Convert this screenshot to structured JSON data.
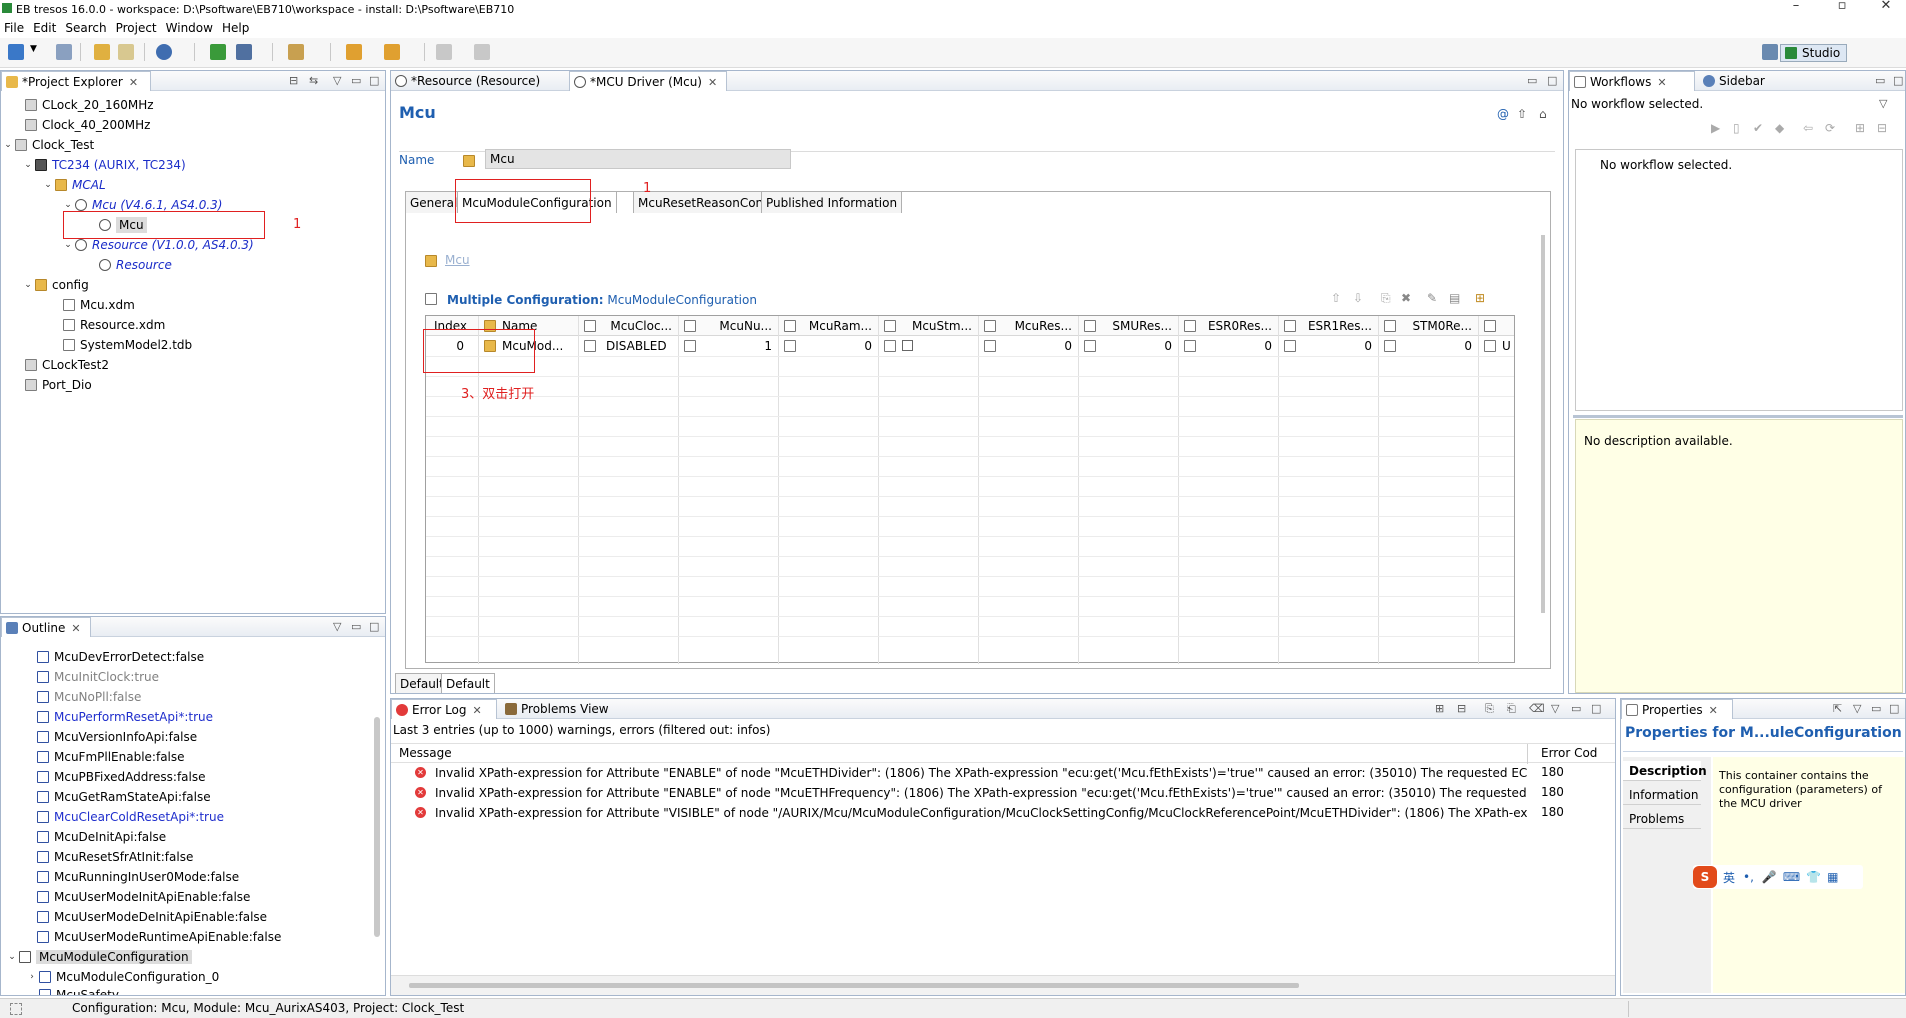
{
  "window": {
    "title": "EB tresos 16.0.0 - workspace: D:\\Psoftware\\EB710\\workspace - install: D:\\Psoftware\\EB710",
    "minimize": "–",
    "maximize": "▫",
    "close": "✕"
  },
  "menu": [
    "File",
    "Edit",
    "Search",
    "Project",
    "Window",
    "Help"
  ],
  "toolbar": {
    "studio_label": "Studio"
  },
  "project_explorer": {
    "tab": "*Project Explorer",
    "items": [
      {
        "label": "CLock_20_160MHz"
      },
      {
        "label": "Clock_40_200MHz"
      },
      {
        "label": "Clock_Test"
      },
      {
        "label": "TC234 (AURIX, TC234)"
      },
      {
        "label": "MCAL"
      },
      {
        "label": "Mcu (V4.6.1, AS4.0.3)"
      },
      {
        "label": "Mcu"
      },
      {
        "label": "Resource (V1.0.0, AS4.0.3)"
      },
      {
        "label": "Resource"
      },
      {
        "label": "config"
      },
      {
        "label": "Mcu.xdm"
      },
      {
        "label": "Resource.xdm"
      },
      {
        "label": "SystemModel2.tdb"
      },
      {
        "label": "CLockTest2"
      },
      {
        "label": "Port_Dio"
      }
    ],
    "annotation": "1"
  },
  "outline": {
    "tab": "Outline",
    "items": [
      "McuDevErrorDetect:false",
      "McuInitClock:true",
      "McuNoPll:false",
      "McuPerformResetApi*:true",
      "McuVersionInfoApi:false",
      "McuFmPllEnable:false",
      "McuPBFixedAddress:false",
      "McuGetRamStateApi:false",
      "McuClearColdResetApi*:true",
      "McuDeInitApi:false",
      "McuResetSfrAtInit:false",
      "McuRunningInUser0Mode:false",
      "McuUserModeInitApiEnable:false",
      "McuUserModeDeInitApiEnable:false",
      "McuUserModeRuntimeApiEnable:false",
      "McuModuleConfiguration",
      "McuModuleConfiguration_0",
      "McuSafety"
    ]
  },
  "editor": {
    "tabs": [
      "*Resource (Resource)",
      "*MCU Driver (Mcu)"
    ],
    "title": "Mcu",
    "name_label": "Name",
    "name_value": "Mcu",
    "subtabs": [
      "General",
      "McuModuleConfiguration",
      "McuResetReasonConf",
      "Published Information"
    ],
    "annotation1": "1",
    "breadcrumb": "Mcu",
    "multi_config_label": "Multiple Configuration:",
    "multi_config_value": "McuModuleConfiguration",
    "columns": [
      "Index",
      "Name",
      "McuCloc...",
      "McuNu...",
      "McuRam...",
      "McuStm...",
      "McuRes...",
      "SMURes...",
      "ESR0Res...",
      "ESR1Res...",
      "STM0Re...",
      ""
    ],
    "row": [
      "0",
      "McuMod...",
      "DISABLED",
      "1",
      "0",
      "",
      "0",
      "0",
      "0",
      "0",
      "0",
      "U"
    ],
    "annotation3": "3、双击打开",
    "bottom_tabs": [
      "Default",
      "Default"
    ]
  },
  "workflows": {
    "tabs": [
      "Workflows",
      "Sidebar"
    ],
    "status": "No workflow selected.",
    "inner_status": "No workflow selected.",
    "description": "No description available."
  },
  "error_log": {
    "tabs": [
      "Error Log",
      "Problems View"
    ],
    "summary": "Last 3 entries (up to 1000) warnings, errors (filtered out: infos)",
    "col_message": "Message",
    "col_error_code": "Error Cod",
    "rows": [
      {
        "message": "Invalid XPath-expression for Attribute \"ENABLE\" of node \"McuETHDivider\": (1806) The XPath-expression \"ecu:get('Mcu.fEthExists')='true'\" caused an error: (35010) The requested ECU resou",
        "code": "180"
      },
      {
        "message": "Invalid XPath-expression for Attribute \"ENABLE\" of node \"McuETHFrequency\": (1806) The XPath-expression \"ecu:get('Mcu.fEthExists')='true'\" caused an error: (35010) The requested ECU re",
        "code": "180"
      },
      {
        "message": "Invalid XPath-expression for Attribute \"VISIBLE\" of node \"/AURIX/Mcu/McuModuleConfiguration/McuClockSettingConfig/McuClockReferencePoint/McuETHDivider\": (1806) The XPath-expre",
        "code": "180"
      }
    ]
  },
  "properties": {
    "tab": "Properties",
    "title": "Properties for M...uleConfiguration",
    "side_tabs": [
      "Description",
      "Information",
      "Problems"
    ],
    "description": "This container contains the configuration (parameters) of the MCU driver",
    "ime": [
      "英",
      "•,",
      "🎤",
      "⌨",
      "👕",
      "▦"
    ]
  },
  "statusbar": {
    "text": "Configuration: Mcu, Module: Mcu_AurixAS403, Project: Clock_Test"
  },
  "colors": {
    "accent": "#1f5fb0",
    "annotation": "#e02020",
    "panel_border": "#a6b6cc"
  }
}
